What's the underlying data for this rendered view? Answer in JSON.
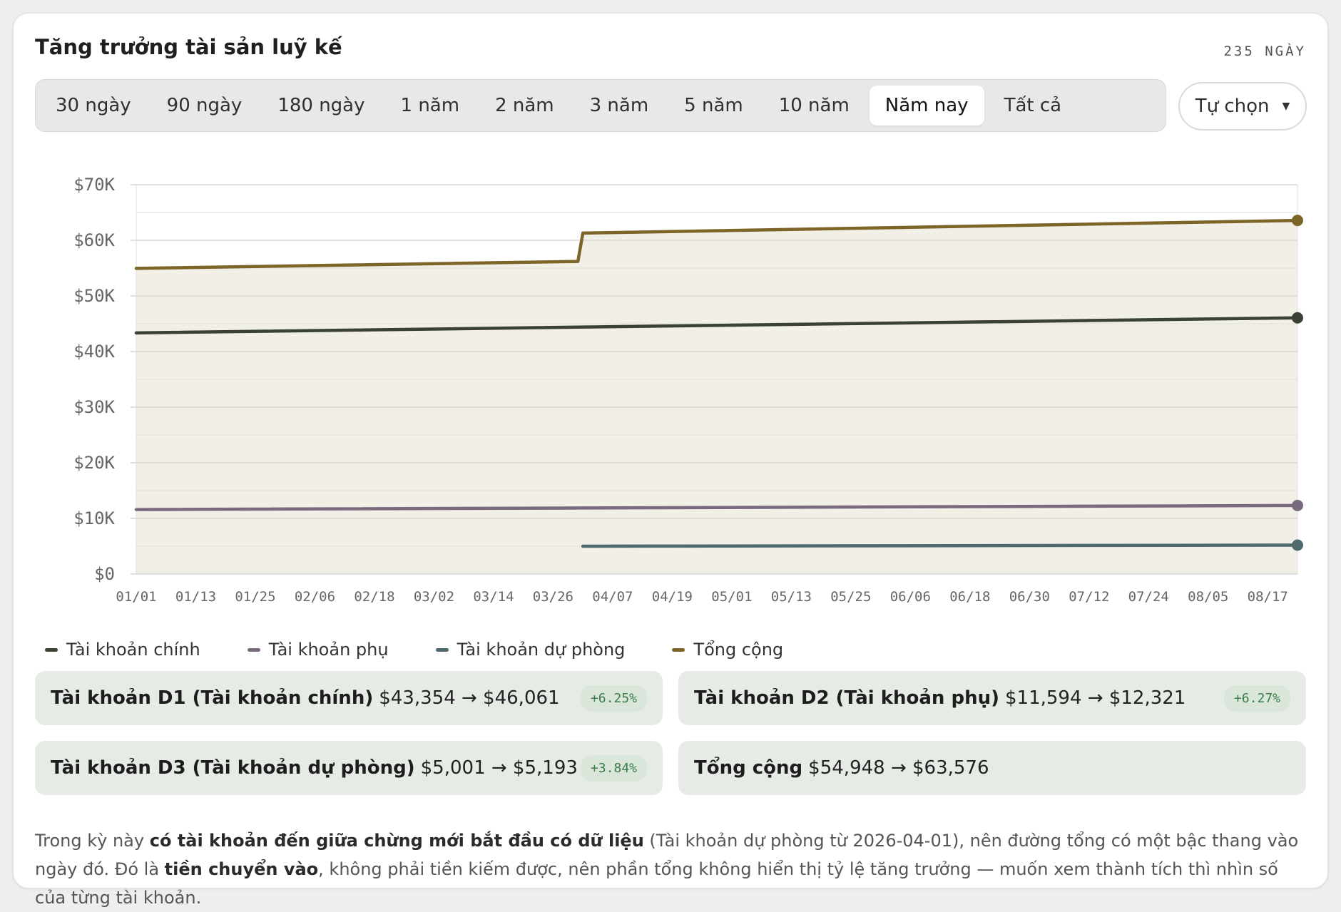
{
  "title": "Tăng trưởng tài sản luỹ kế",
  "days_label": "235 NGÀY",
  "range_tabs": [
    {
      "label": "30 ngày",
      "active": false
    },
    {
      "label": "90 ngày",
      "active": false
    },
    {
      "label": "180 ngày",
      "active": false
    },
    {
      "label": "1 năm",
      "active": false
    },
    {
      "label": "2 năm",
      "active": false
    },
    {
      "label": "3 năm",
      "active": false
    },
    {
      "label": "5 năm",
      "active": false
    },
    {
      "label": "10 năm",
      "active": false
    },
    {
      "label": "Năm nay",
      "active": true
    },
    {
      "label": "Tất cả",
      "active": false
    }
  ],
  "custom_button": {
    "label": "Tự chọn",
    "icon": "caret-down-icon"
  },
  "chart_data": {
    "type": "area",
    "title": "",
    "xlabel": "",
    "ylabel": "",
    "ylim": [
      0,
      70000
    ],
    "yticks": [
      0,
      10000,
      20000,
      30000,
      40000,
      50000,
      60000,
      70000
    ],
    "ytick_labels": [
      "$0",
      "$10K",
      "$20K",
      "$30K",
      "$40K",
      "$50K",
      "$60K",
      "$70K"
    ],
    "xlim": [
      "2026-01-01",
      "2026-08-23"
    ],
    "xticks": [
      "2026-01-01",
      "2026-01-13",
      "2026-01-25",
      "2026-02-06",
      "2026-02-18",
      "2026-03-02",
      "2026-03-14",
      "2026-03-26",
      "2026-04-07",
      "2026-04-19",
      "2026-05-01",
      "2026-05-13",
      "2026-05-25",
      "2026-06-06",
      "2026-06-18",
      "2026-06-30",
      "2026-07-12",
      "2026-07-24",
      "2026-08-05",
      "2026-08-17"
    ],
    "xtick_labels": [
      "01/01",
      "01/13",
      "01/25",
      "02/06",
      "02/18",
      "03/02",
      "03/14",
      "03/26",
      "04/07",
      "04/19",
      "05/01",
      "05/13",
      "05/25",
      "06/06",
      "06/18",
      "06/30",
      "07/12",
      "07/24",
      "08/05",
      "08/17"
    ],
    "grid": true,
    "legend": "bottom-left",
    "series": [
      {
        "name": "Tài khoản chính",
        "color": "#3a4236",
        "x": [
          "2026-01-01",
          "2026-08-23"
        ],
        "y": [
          43354,
          46061
        ]
      },
      {
        "name": "Tài khoản phụ",
        "color": "#7a6a80",
        "x": [
          "2026-01-01",
          "2026-08-23"
        ],
        "y": [
          11594,
          12321
        ]
      },
      {
        "name": "Tài khoản dự phòng",
        "color": "#4e6a6e",
        "x": [
          "2026-04-01",
          "2026-08-23"
        ],
        "y": [
          5001,
          5193
        ]
      },
      {
        "name": "Tổng cộng",
        "color": "#7d6528",
        "fill": "#f2efe7",
        "x": [
          "2026-01-01",
          "2026-03-31",
          "2026-04-01",
          "2026-08-23"
        ],
        "y": [
          54948,
          56200,
          61300,
          63576
        ]
      }
    ]
  },
  "stats": [
    {
      "name": "Tài khoản D1 (Tài khoản chính)",
      "values": "$43,354 → $46,061",
      "change": "+6.25%"
    },
    {
      "name": "Tài khoản D2 (Tài khoản phụ)",
      "values": "$11,594 → $12,321",
      "change": "+6.27%"
    },
    {
      "name": "Tài khoản D3 (Tài khoản dự phòng)",
      "values": "$5,001 → $5,193",
      "change": "+3.84%"
    },
    {
      "name": "Tổng cộng",
      "values": "$54,948 → $63,576",
      "change": ""
    }
  ],
  "note": {
    "p1": "Trong kỳ này ",
    "b1": "có tài khoản đến giữa chừng mới bắt đầu có dữ liệu",
    "p2": " (Tài khoản dự phòng từ 2026-04-01), nên đường tổng có một bậc thang vào ngày đó. Đó là ",
    "b2": "tiền chuyển vào",
    "p3": ", không phải tiền kiếm được, nên phần tổng không hiển thị tỷ lệ tăng trưởng — muốn xem thành tích thì nhìn số của từng tài khoản."
  }
}
